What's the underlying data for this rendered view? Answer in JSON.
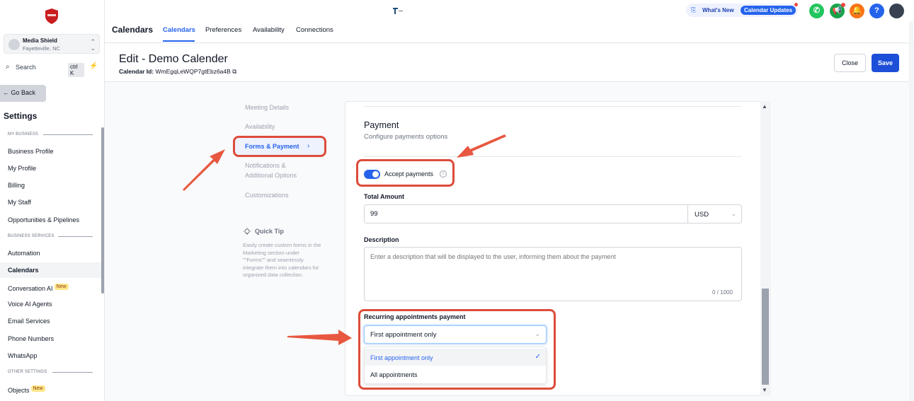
{
  "account": {
    "name": "Media Shield",
    "location": "Fayetteville, NC"
  },
  "search": {
    "label": "Search",
    "shortcut": "ctrl K"
  },
  "sidebar": {
    "go_back": "← Go Back",
    "title": "Settings",
    "sections": {
      "my_business": "MY BUSINESS",
      "business_services": "BUSINESS SERVICES",
      "other_settings": "OTHER SETTINGS"
    },
    "items": [
      {
        "label": "Business Profile"
      },
      {
        "label": "My Profile"
      },
      {
        "label": "Billing"
      },
      {
        "label": "My Staff"
      },
      {
        "label": "Opportunities & Pipelines"
      },
      {
        "label": "Automation"
      },
      {
        "label": "Calendars"
      },
      {
        "label": "Conversation AI"
      },
      {
        "label": "Voice AI Agents"
      },
      {
        "label": "Email Services"
      },
      {
        "label": "Phone Numbers"
      },
      {
        "label": "WhatsApp"
      },
      {
        "label": "Objects"
      }
    ],
    "new_badge": "New"
  },
  "topbar": {
    "title": "Calendars",
    "tabs": [
      "Calendars",
      "Preferences",
      "Availability",
      "Connections"
    ],
    "whats_new": "What's New",
    "calendar_updates": "Calendar Updates",
    "help": "?"
  },
  "header": {
    "title": "Edit - Demo Calender",
    "calendar_id_label": "Calendar Id:",
    "calendar_id": "WmEgqLeWQP7gtEbz6a4B",
    "close": "Close",
    "save": "Save"
  },
  "subnav": {
    "items": [
      "Meeting Details",
      "Availability",
      "Forms & Payment",
      "Notifications &",
      "Additional Options",
      "Customizations"
    ],
    "quick_tip_title": "Quick Tip",
    "quick_tip_text": "Easily create custom forms in the Marketing section under \"\"Forms\"\" and seamlessly integrate them into calendars for organized data collection."
  },
  "payment": {
    "title": "Payment",
    "subtitle": "Configure payments options",
    "accept_label": "Accept payments",
    "total_amount_label": "Total Amount",
    "amount": "99",
    "currency": "USD",
    "description_label": "Description",
    "description_placeholder": "Enter a description that will be displayed to the user, informing them about the payment",
    "char_count": "0 / 1000",
    "recurring_label": "Recurring appointments payment",
    "recurring_value": "First appointment only",
    "options": [
      "First appointment only",
      "All appointments"
    ]
  },
  "colors": {
    "accent": "#2563eb",
    "annotation": "#dc4c3a"
  }
}
